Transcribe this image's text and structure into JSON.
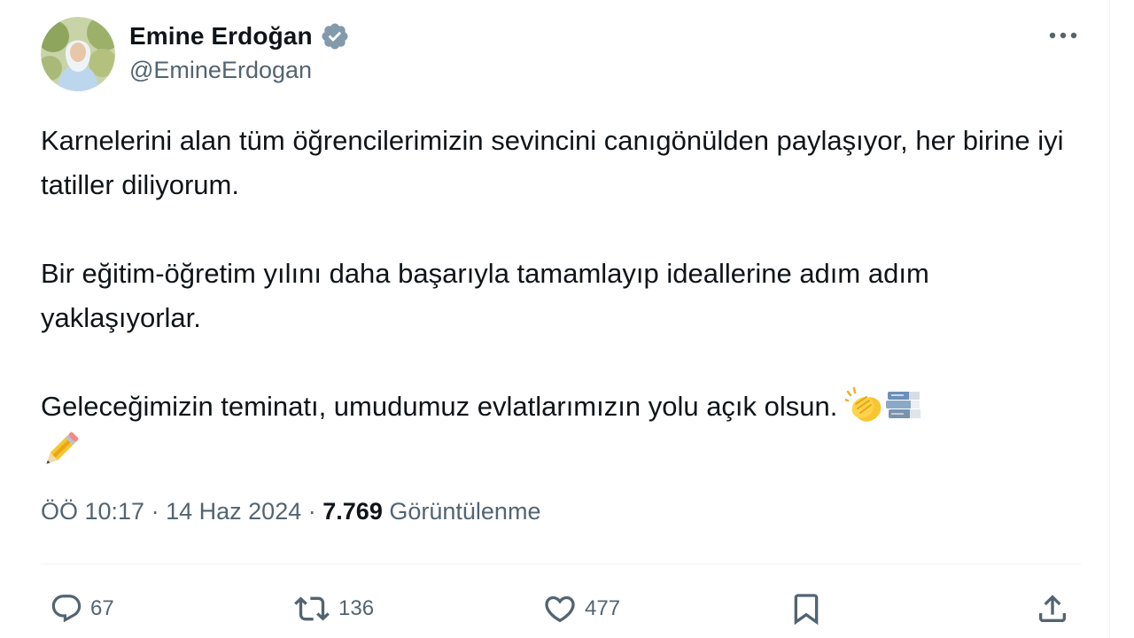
{
  "author": {
    "display_name": "Emine Erdoğan",
    "handle": "@EmineErdogan",
    "verified": true,
    "verified_badge_color": "#829aab"
  },
  "tweet": {
    "paragraphs": [
      "Karnelerini alan tüm öğrencilerimizin sevincini canıgönülden paylaşıyor, her birine iyi tatiller diliyorum.",
      "Bir eğitim-öğretim yılını daha başarıyla tamamlayıp ideallerine adım adım yaklaşıyorlar.",
      "Geleceğimizin teminatı, umudumuz evlatlarımızın yolu açık olsun."
    ],
    "emojis": [
      "clapping-hands-emoji",
      "books-emoji",
      "pencil-emoji"
    ]
  },
  "meta": {
    "time": "ÖÖ 10:17",
    "separator": "·",
    "date": "14 Haz 2024",
    "views_count": "7.769",
    "views_label": "Görüntülenme"
  },
  "actions": {
    "replies": "67",
    "retweets": "136",
    "likes": "477"
  },
  "colors": {
    "text_primary": "#0f1419",
    "text_secondary": "#536471",
    "divider": "#eff3f4"
  }
}
